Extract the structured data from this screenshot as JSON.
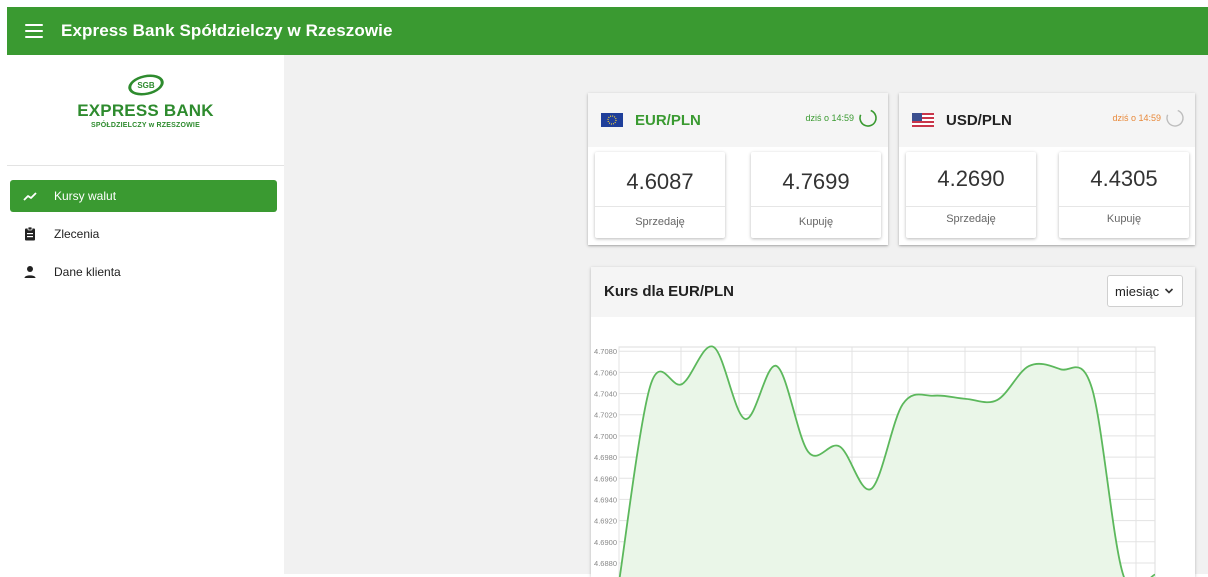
{
  "header": {
    "title": "Express Bank Spółdzielczy w Rzeszowie",
    "menu_icon": "menu-icon"
  },
  "logo": {
    "seal": "SGB",
    "name": "EXPRESS BANK",
    "sub": "SPÓŁDZIELCZY w RZESZOWIE"
  },
  "sidebar": {
    "items": [
      {
        "label": "Kursy walut",
        "icon": "trending-up-icon",
        "active": true
      },
      {
        "label": "Zlecenia",
        "icon": "clipboard-icon",
        "active": false
      },
      {
        "label": "Dane klienta",
        "icon": "person-icon",
        "active": false
      }
    ]
  },
  "rates": [
    {
      "pair": "EUR/PLN",
      "flag": "eu-flag-icon",
      "time": "dziś o 14:59",
      "time_color": "#3a9a31",
      "sell": "4.6087",
      "sell_label": "Sprzedaję",
      "buy": "4.7699",
      "buy_label": "Kupuję"
    },
    {
      "pair": "USD/PLN",
      "flag": "us-flag-icon",
      "time": "dziś o 14:59",
      "time_color": "#e8893a",
      "sell": "4.2690",
      "sell_label": "Sprzedaję",
      "buy": "4.4305",
      "buy_label": "Kupuję"
    }
  ],
  "chart_section": {
    "title": "Kurs dla EUR/PLN",
    "period": "miesiąc"
  },
  "chart_data": {
    "type": "area",
    "title": "Kurs dla EUR/PLN",
    "xlabel": "",
    "ylabel": "",
    "y_ticks": [
      4.708,
      4.706,
      4.704,
      4.702,
      4.7,
      4.698,
      4.696,
      4.694,
      4.692,
      4.69,
      4.688
    ],
    "ylim": [
      4.6862,
      4.7084
    ],
    "grid": true,
    "series": [
      {
        "values": [
          4.6862,
          4.7048,
          4.7049,
          4.7084,
          4.7016,
          4.7066,
          4.6985,
          4.699,
          4.695,
          4.703,
          4.7038,
          4.7035,
          4.7034,
          4.7066,
          4.7063,
          4.7045,
          4.6868,
          4.6869
        ]
      }
    ],
    "x": [
      0,
      1,
      2,
      3,
      4,
      5,
      6,
      7,
      8,
      9,
      10,
      11,
      12,
      13,
      14,
      15,
      16,
      17
    ],
    "line_color": "#5cb85c",
    "fill_color": "#eaf6e8"
  }
}
